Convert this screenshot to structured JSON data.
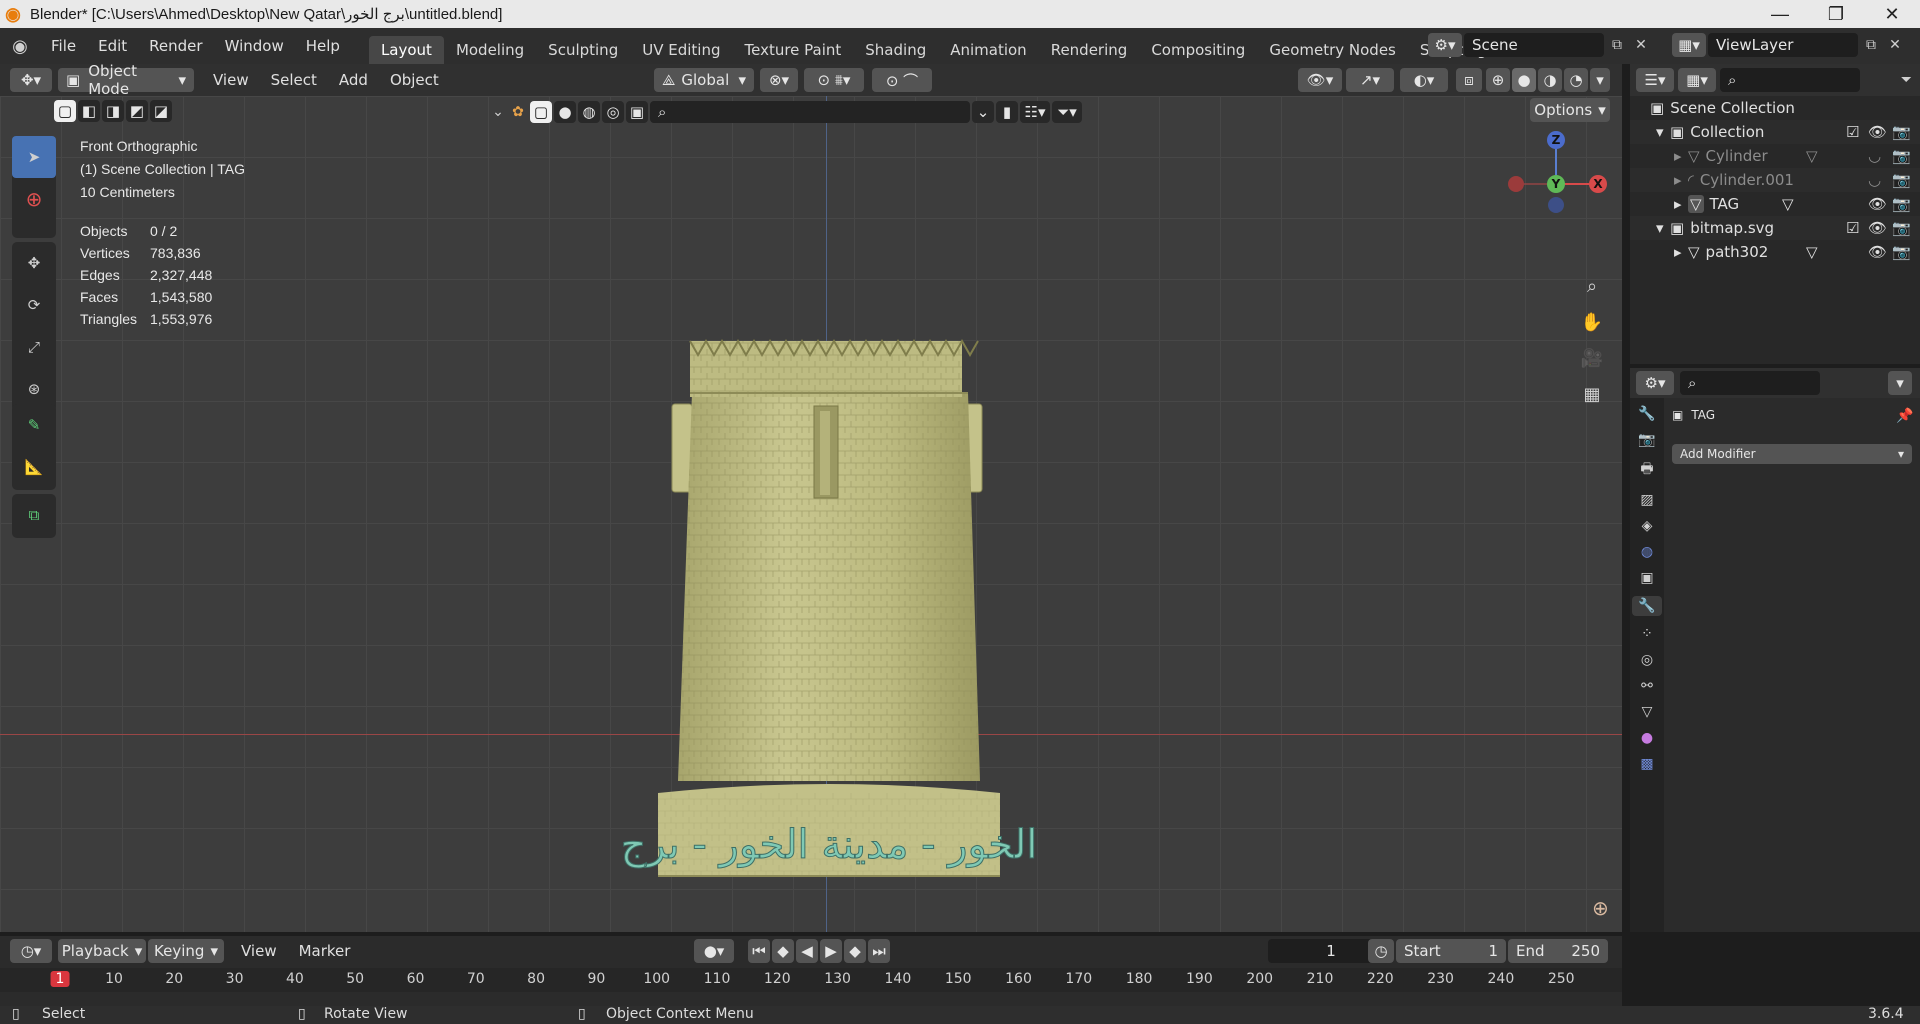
{
  "titlebar": {
    "title": "Blender* [C:\\Users\\Ahmed\\Desktop\\New Qatar\\برج الخور\\untitled.blend]"
  },
  "menu": {
    "file": "File",
    "edit": "Edit",
    "render": "Render",
    "window": "Window",
    "help": "Help"
  },
  "workspaces": [
    "Layout",
    "Modeling",
    "Sculpting",
    "UV Editing",
    "Texture Paint",
    "Shading",
    "Animation",
    "Rendering",
    "Compositing",
    "Geometry Nodes",
    "Scripting"
  ],
  "scene": {
    "name": "Scene",
    "view_layer": "ViewLayer"
  },
  "viewport_header": {
    "mode": "Object Mode",
    "view": "View",
    "select": "Select",
    "add": "Add",
    "object": "Object",
    "orientation": "Global",
    "options": "Options"
  },
  "overlay_info": {
    "view_name": "Front Orthographic",
    "collection": "(1) Scene Collection | TAG",
    "scale": "10 Centimeters",
    "stats": [
      {
        "label": "Objects",
        "value": "0 / 2"
      },
      {
        "label": "Vertices",
        "value": "783,836"
      },
      {
        "label": "Edges",
        "value": "2,327,448"
      },
      {
        "label": "Faces",
        "value": "1,543,580"
      },
      {
        "label": "Triangles",
        "value": "1,553,976"
      }
    ]
  },
  "model": {
    "text": "الخور - مدينة الخور - برج"
  },
  "gizmo": {
    "z": "Z",
    "y": "Y",
    "x": "X"
  },
  "outliner": {
    "root": "Scene Collection",
    "items": [
      {
        "name": "Collection",
        "level": 1
      },
      {
        "name": "Cylinder",
        "level": 2
      },
      {
        "name": "Cylinder.001",
        "level": 2
      },
      {
        "name": "TAG",
        "level": 2
      },
      {
        "name": "bitmap.svg",
        "level": 1
      },
      {
        "name": "path302",
        "level": 2
      }
    ]
  },
  "properties": {
    "object": "TAG",
    "add_modifier": "Add Modifier"
  },
  "timeline": {
    "playback": "Playback",
    "keying": "Keying",
    "view": "View",
    "marker": "Marker",
    "current_frame": "1",
    "start_label": "Start",
    "start": "1",
    "end_label": "End",
    "end": "250",
    "ruler": [
      "1",
      "10",
      "20",
      "30",
      "40",
      "50",
      "60",
      "70",
      "80",
      "90",
      "100",
      "110",
      "120",
      "130",
      "140",
      "150",
      "160",
      "170",
      "180",
      "190",
      "200",
      "210",
      "220",
      "230",
      "240",
      "250"
    ]
  },
  "statusbar": {
    "select": "Select",
    "rotate": "Rotate View",
    "context": "Object Context Menu",
    "version": "3.6.4"
  },
  "colors": {
    "accent": "#4772b3",
    "model": "#b9b67f",
    "text_relief": "#7fc9b4"
  }
}
